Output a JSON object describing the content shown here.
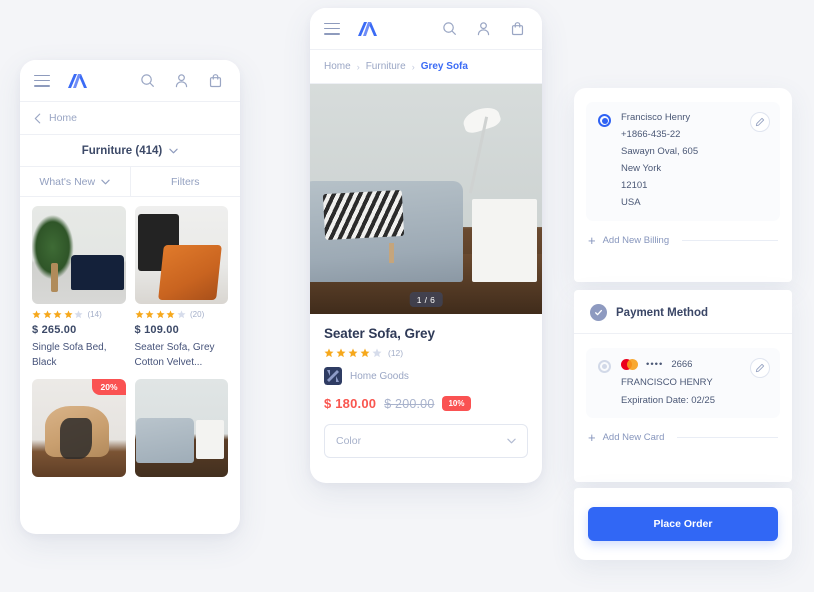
{
  "brand": {
    "logo_name": "app-logo"
  },
  "left_phone": {
    "appbar": {
      "menu_label": "menu",
      "search_label": "Search",
      "account_label": "Account",
      "cart_label": "Cart"
    },
    "back_row": {
      "label": "Home"
    },
    "category_row": {
      "label": "Furniture (414)"
    },
    "filter_row": {
      "sort_label": "What's New",
      "filters_label": "Filters"
    },
    "products": [
      {
        "image": "img-plantsofa",
        "rating": 4,
        "reviews": "(14)",
        "price": "$ 265.00",
        "title": "Single Sofa Bed, Black",
        "discount": ""
      },
      {
        "image": "img-chair-orange",
        "rating": 4,
        "reviews": "(20)",
        "price": "$ 109.00",
        "title": "Seater Sofa, Grey Cotton Velvet...",
        "discount": ""
      },
      {
        "image": "img-rattan",
        "rating": 0,
        "reviews": "",
        "price": "",
        "title": "",
        "discount": "20%"
      },
      {
        "image": "img-greysofa",
        "rating": 0,
        "reviews": "",
        "price": "",
        "title": "",
        "discount": ""
      }
    ]
  },
  "center_phone": {
    "breadcrumbs": [
      {
        "label": "Home",
        "active": false
      },
      {
        "label": "Furniture",
        "active": false
      },
      {
        "label": "Grey Sofa",
        "active": true
      }
    ],
    "breadcrumb_separator": "›",
    "hero": {
      "pager": "1 / 6"
    },
    "product": {
      "title": "Seater Sofa, Grey",
      "rating": 4,
      "reviews": "(12)",
      "brand": "Home Goods",
      "price_current": "$ 180.00",
      "price_original": "$ 200.00",
      "discount_badge": "10%",
      "color_select_placeholder": "Color"
    }
  },
  "right_panel": {
    "billing": {
      "name": "Francisco Henry",
      "phone": "+1866-435-22",
      "street": "Sawayn Oval, 605",
      "city": "New York",
      "zip": "12101",
      "country": "USA",
      "edit_label": "Edit billing address",
      "add_label": "Add New Billing"
    },
    "payment": {
      "section_title": "Payment Method",
      "card_brand": "mastercard",
      "card_dots": "••••",
      "card_last4": "2666",
      "card_holder": "FRANCISCO HENRY",
      "expiration": "Expiration Date: 02/25",
      "edit_label": "Edit card",
      "add_label": "Add New Card"
    },
    "action": {
      "place_order_label": "Place Order"
    }
  },
  "colors": {
    "accent_blue": "#3167f5",
    "logo_blue": "#3b6bf5",
    "star_gold": "#f6a81c",
    "star_empty": "#d6dceb",
    "price_red": "#f9564f",
    "badge_red": "#fa5252",
    "text_dark": "#3a4666",
    "text_muted": "#9aa6c4",
    "page_bg": "#f4f5f8"
  }
}
